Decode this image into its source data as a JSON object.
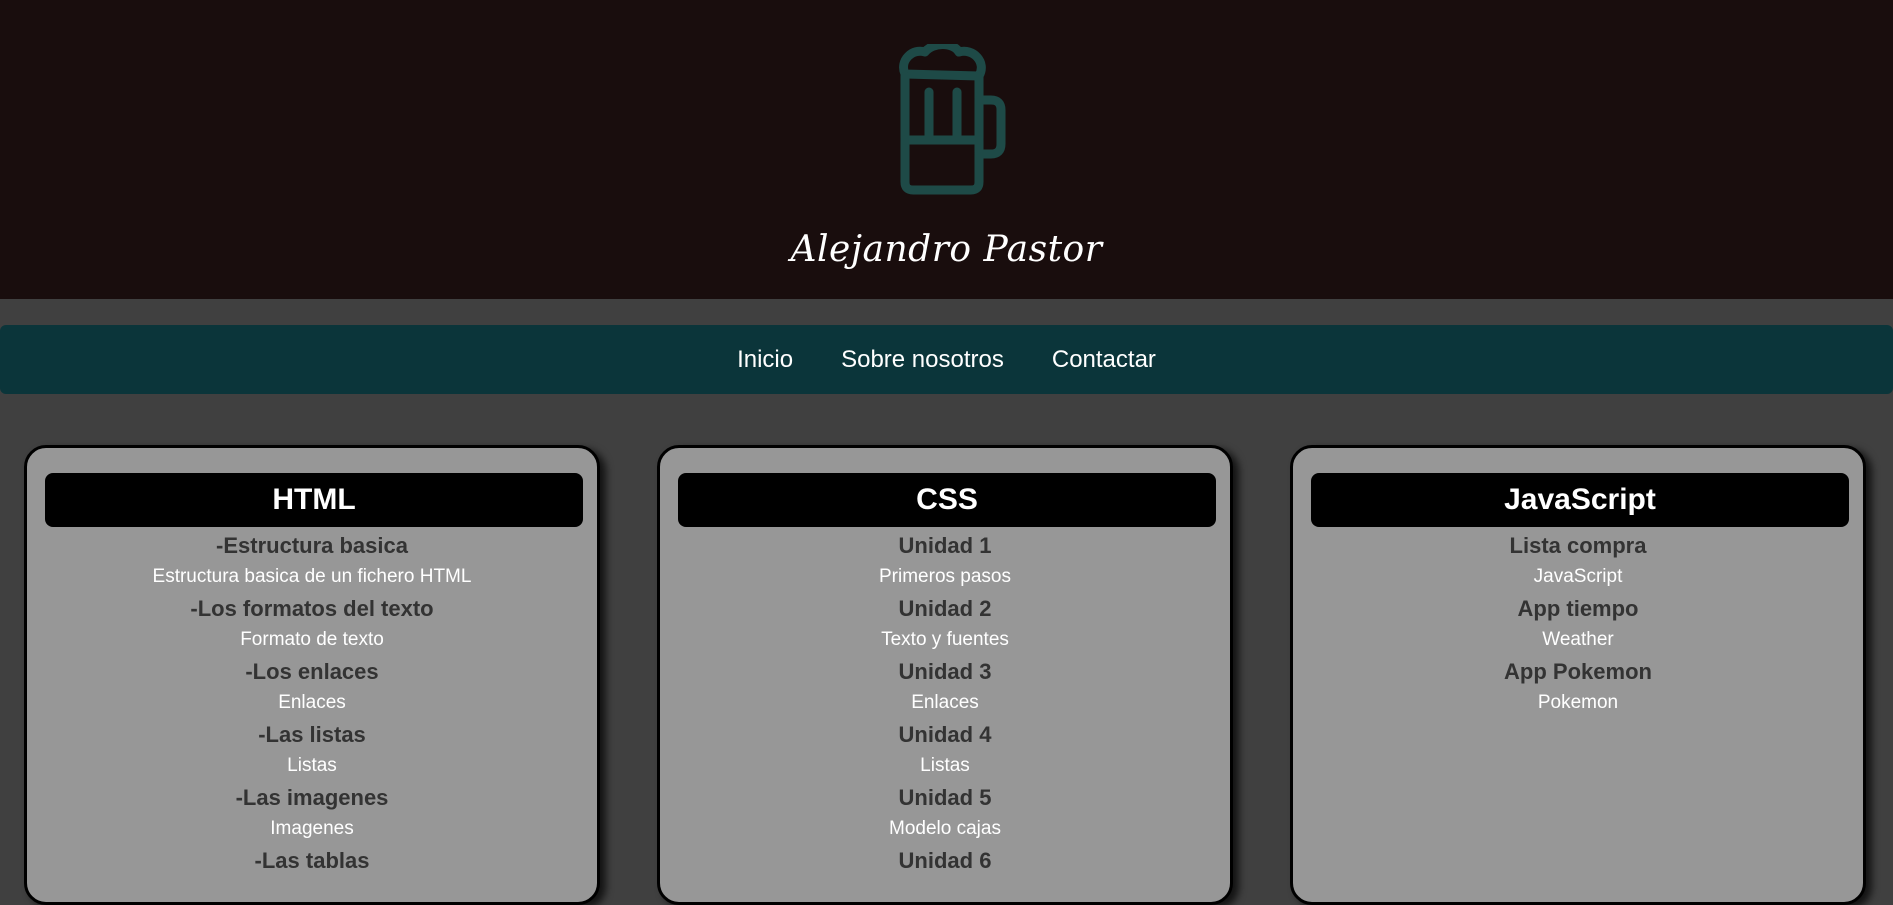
{
  "header": {
    "site_title": "Alejandro Pastor",
    "logo_icon": "beer-mug-icon",
    "logo_color": "#1e4a47"
  },
  "nav": {
    "items": [
      "Inicio",
      "Sobre nosotros",
      "Contactar"
    ]
  },
  "cards": [
    {
      "title": "HTML",
      "items": [
        {
          "title": "-Estructura basica",
          "link": "Estructura basica de un fichero HTML"
        },
        {
          "title": "-Los formatos del texto",
          "link": "Formato de texto"
        },
        {
          "title": "-Los enlaces",
          "link": "Enlaces"
        },
        {
          "title": "-Las listas",
          "link": "Listas"
        },
        {
          "title": "-Las imagenes",
          "link": "Imagenes"
        },
        {
          "title": "-Las tablas",
          "link": ""
        }
      ]
    },
    {
      "title": "CSS",
      "items": [
        {
          "title": "Unidad 1",
          "link": "Primeros pasos"
        },
        {
          "title": "Unidad 2",
          "link": "Texto y fuentes"
        },
        {
          "title": "Unidad 3",
          "link": "Enlaces"
        },
        {
          "title": "Unidad 4",
          "link": "Listas"
        },
        {
          "title": "Unidad 5",
          "link": "Modelo cajas"
        },
        {
          "title": "Unidad 6",
          "link": ""
        }
      ]
    },
    {
      "title": "JavaScript",
      "items": [
        {
          "title": "Lista compra",
          "link": "JavaScript"
        },
        {
          "title": "App tiempo",
          "link": "Weather"
        },
        {
          "title": "App Pokemon",
          "link": "Pokemon"
        }
      ]
    }
  ],
  "colors": {
    "header_bg": "#190d0d",
    "page_bg": "#404040",
    "nav_bg": "#0b353a",
    "card_bg": "#979797"
  }
}
